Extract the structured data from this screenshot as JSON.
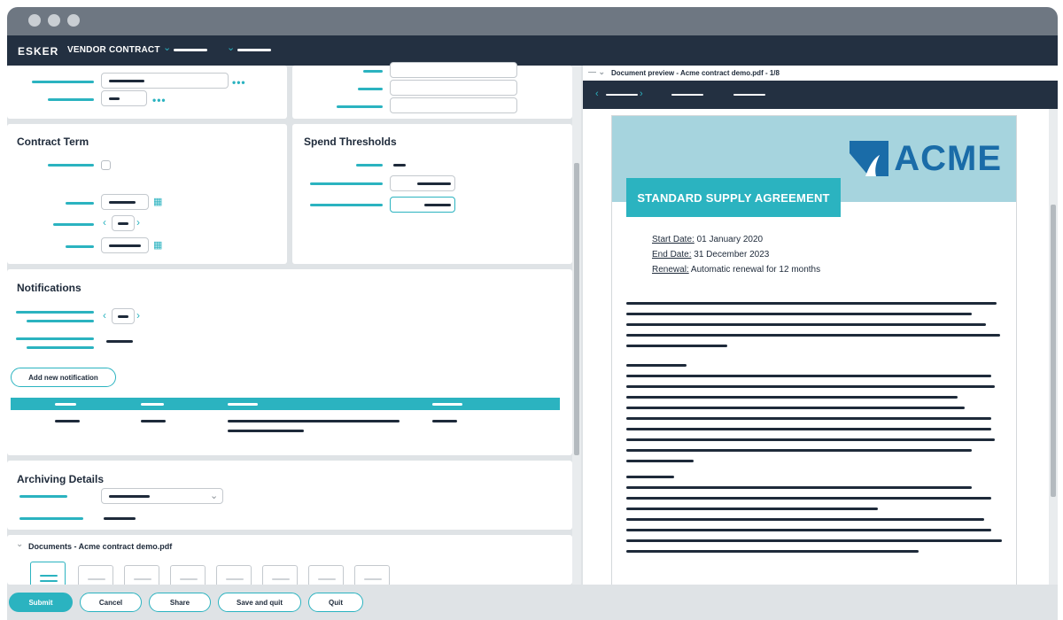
{
  "app": {
    "logo": "ESKER",
    "title": "VENDOR CONTRACT"
  },
  "sections": {
    "contract_term": "Contract Term",
    "spend_thresholds": "Spend Thresholds",
    "notifications": "Notifications",
    "archiving": "Archiving Details",
    "documents": "Documents - Acme contract demo.pdf"
  },
  "notifications": {
    "add_label": "Add new notification"
  },
  "preview": {
    "header": "Document preview - Acme contract demo.pdf - 1/8",
    "brand": "ACME",
    "agreement_title": "STANDARD SUPPLY AGREEMENT",
    "start_label": "Start Date:",
    "start_value": " 01 January 2020",
    "end_label": "End Date:",
    "end_value": " 31 December 2023",
    "renewal_label": "Renewal:",
    "renewal_value": " Automatic renewal for 12 months"
  },
  "footer": {
    "submit": "Submit",
    "cancel": "Cancel",
    "share": "Share",
    "save_quit": "Save and quit",
    "quit": "Quit"
  },
  "colors": {
    "accent": "#2bb3c0",
    "header": "#233041",
    "brand": "#1a6ca8",
    "band": "#a6d4de"
  },
  "icons": {
    "calendar": "calendar-icon",
    "more": "more-dots-icon",
    "chevron": "chevron-down-icon",
    "document": "document-icon"
  }
}
